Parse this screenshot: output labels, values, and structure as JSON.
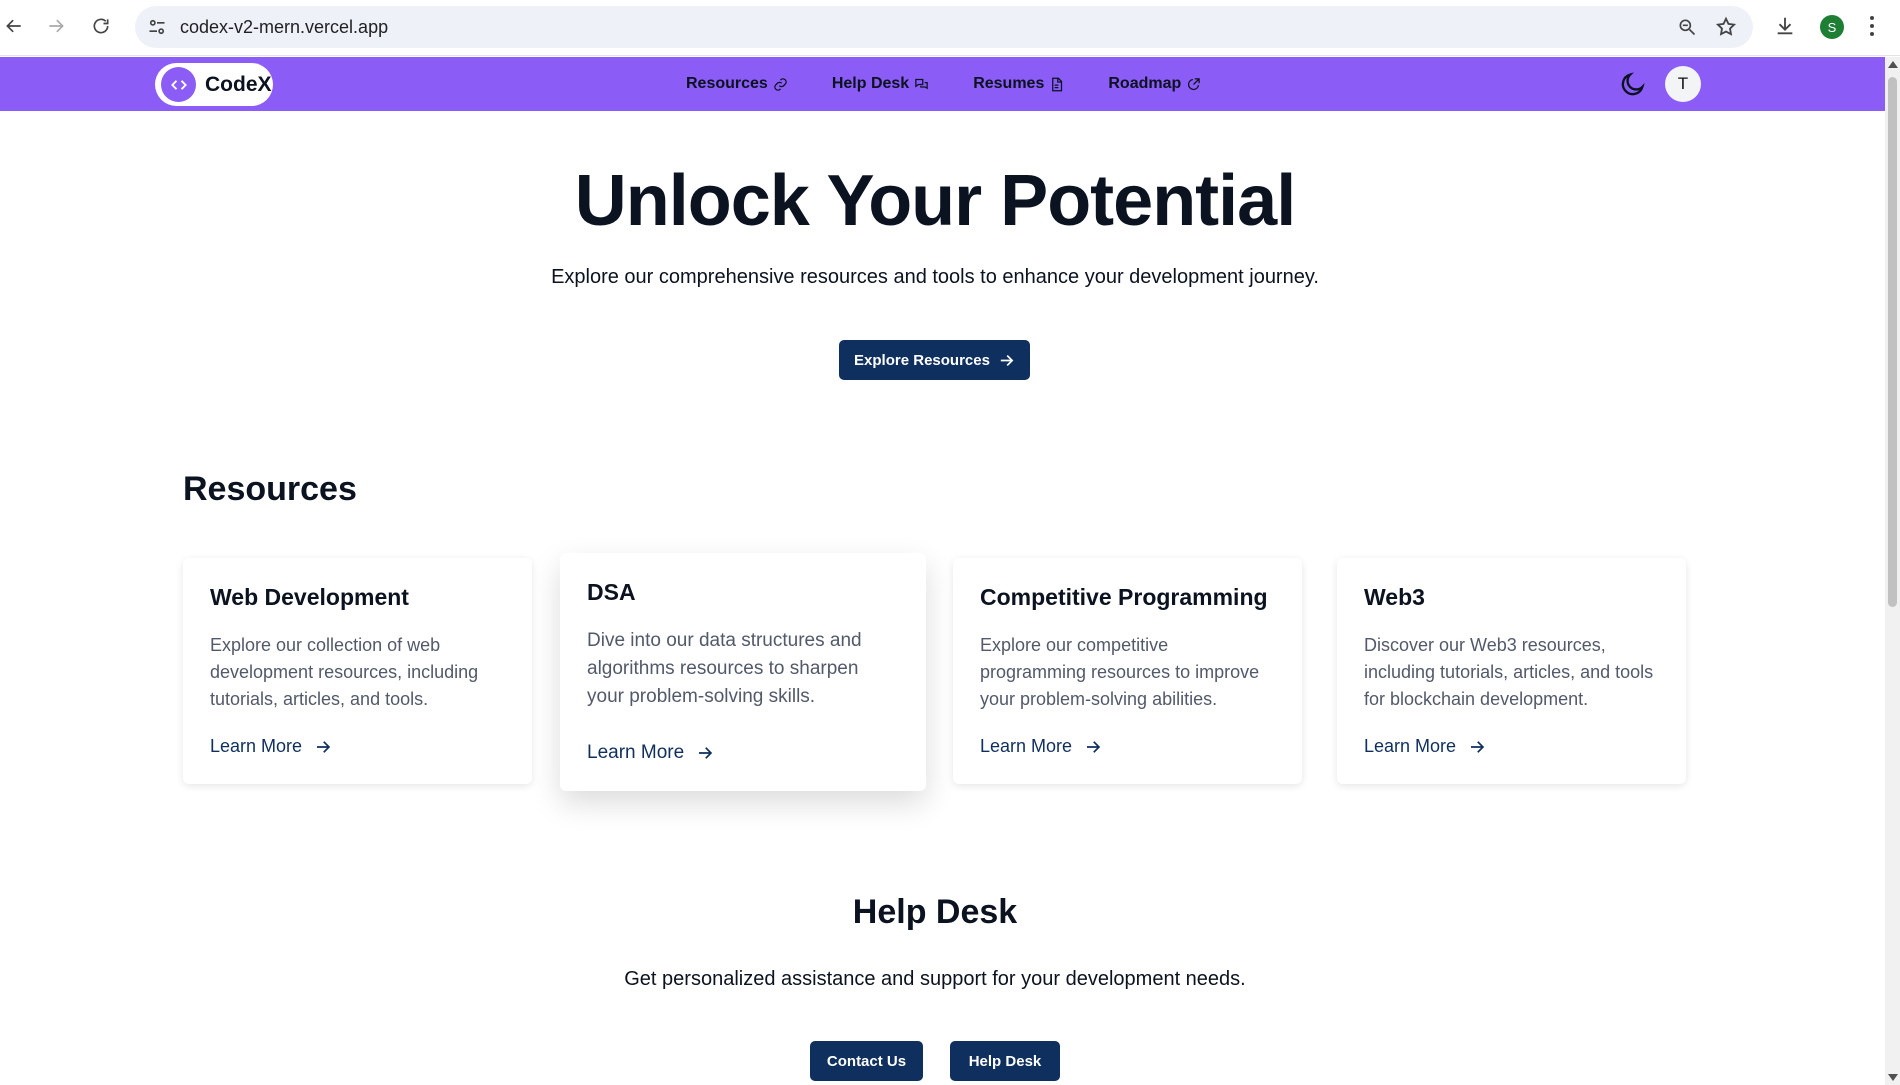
{
  "browser": {
    "url": "codex-v2-mern.vercel.app",
    "profile_initial": "S"
  },
  "navbar": {
    "brand": "CodeX",
    "links": [
      {
        "label": "Resources",
        "icon": "link-icon"
      },
      {
        "label": "Help Desk",
        "icon": "messages-icon"
      },
      {
        "label": "Resumes",
        "icon": "document-icon"
      },
      {
        "label": "Roadmap",
        "icon": "external-link-icon"
      }
    ],
    "avatar_initial": "T"
  },
  "hero": {
    "title": "Unlock Your Potential",
    "subtitle": "Explore our comprehensive resources and tools to enhance your development journey.",
    "cta_label": "Explore Resources"
  },
  "resources": {
    "title": "Resources",
    "cards": [
      {
        "title": "Web Development",
        "description": "Explore our collection of web development resources, including tutorials, articles, and tools.",
        "link": "Learn More"
      },
      {
        "title": "DSA",
        "description": "Dive into our data structures and algorithms resources to sharpen your problem-solving skills.",
        "link": "Learn More"
      },
      {
        "title": "Competitive Programming",
        "description": "Explore our competitive programming resources to improve your problem-solving abilities.",
        "link": "Learn More"
      },
      {
        "title": "Web3",
        "description": "Discover our Web3 resources, including tutorials, articles, and tools for blockchain development.",
        "link": "Learn More"
      }
    ]
  },
  "helpdesk": {
    "title": "Help Desk",
    "subtitle": "Get personalized assistance and support for your development needs.",
    "contact_label": "Contact Us",
    "helpdesk_label": "Help Desk"
  },
  "colors": {
    "navbar": "#8b5cf6",
    "primary_button": "#0f2f5e",
    "text": "#0b1220",
    "muted_text": "#52596a"
  }
}
